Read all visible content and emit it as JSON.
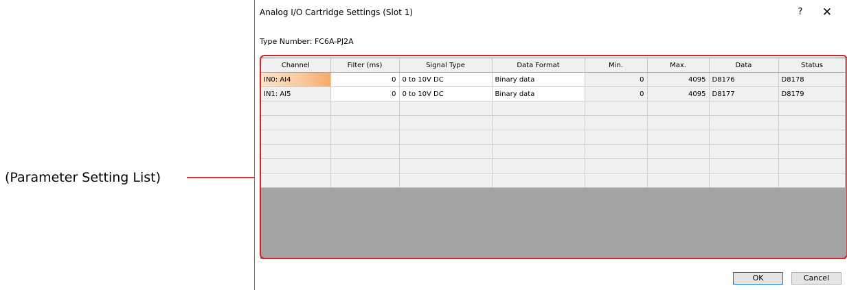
{
  "callout": {
    "label": "(Parameter Setting List)"
  },
  "dialog": {
    "title": "Analog I/O Cartridge Settings (Slot 1)",
    "help": "?",
    "close": "✕",
    "type_number": "Type Number: FC6A-PJ2A",
    "ok_label": "OK",
    "cancel_label": "Cancel"
  },
  "table": {
    "columns": [
      "Channel",
      "Filter (ms)",
      "Signal Type",
      "Data Format",
      "Min.",
      "Max.",
      "Data",
      "Status"
    ],
    "rows": [
      [
        "IN0: AI4",
        "0",
        "0 to 10V DC",
        "Binary data",
        "0",
        "4095",
        "D8176",
        "D8178"
      ],
      [
        "IN1: AI5",
        "0",
        "0 to 10V DC",
        "Binary data",
        "0",
        "4095",
        "D8177",
        "D8179"
      ]
    ],
    "empty_row_count": 6
  },
  "colors": {
    "highlight": "#e02020",
    "selected_cell": "#f6a96a",
    "grid_empty": "#a3a3a3"
  }
}
